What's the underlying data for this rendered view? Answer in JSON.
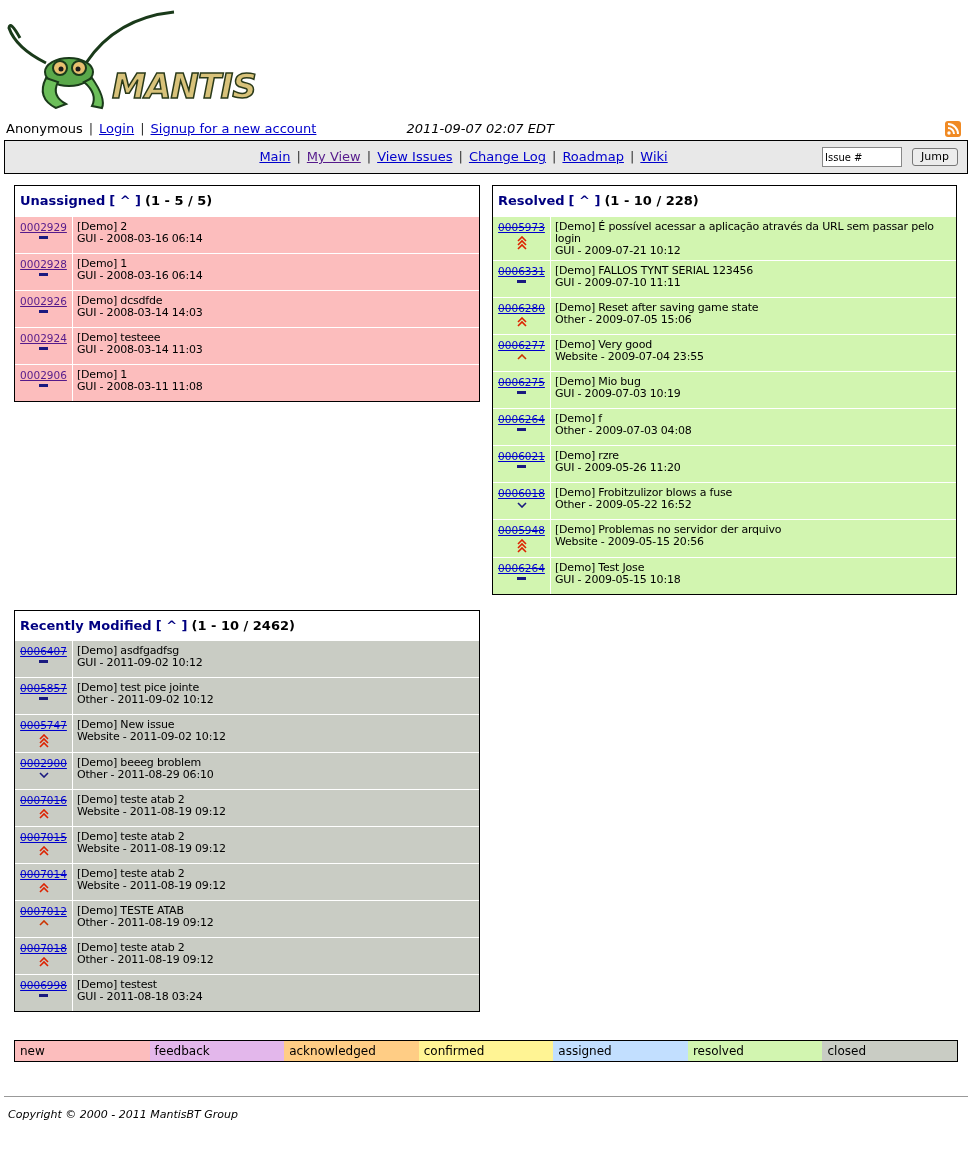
{
  "logo": {
    "text": "MANTIS"
  },
  "user_bar": {
    "user": "Anonymous",
    "separator": "|",
    "links": [
      "Login",
      "Signup for a new account"
    ],
    "datetime": "2011-09-07 02:07 EDT"
  },
  "menu": {
    "separator": "|",
    "links": [
      {
        "label": "Main",
        "visited": false
      },
      {
        "label": "My View",
        "visited": true
      },
      {
        "label": "View Issues",
        "visited": false
      },
      {
        "label": "Change Log",
        "visited": false
      },
      {
        "label": "Roadmap",
        "visited": false
      },
      {
        "label": "Wiki",
        "visited": false
      }
    ],
    "jump": {
      "placeholder": "Issue #",
      "button": "Jump"
    }
  },
  "panels": [
    {
      "title": "Unassigned",
      "toggle": "[ ^ ]",
      "range": "(1 - 5 / 5)",
      "color": "#fcbdbd",
      "ids_struck": false,
      "rows": [
        {
          "id": "0002929",
          "visited": true,
          "kind": "normal",
          "summary": "[Demo] 2",
          "meta": "GUI - 2008-03-16 06:14"
        },
        {
          "id": "0002928",
          "visited": true,
          "kind": "normal",
          "summary": "[Demo] 1",
          "meta": "GUI - 2008-03-16 06:14"
        },
        {
          "id": "0002926",
          "visited": true,
          "kind": "normal",
          "summary": "[Demo] dcsdfde",
          "meta": "GUI - 2008-03-14 14:03"
        },
        {
          "id": "0002924",
          "visited": true,
          "kind": "normal",
          "summary": "[Demo] testeee",
          "meta": "GUI - 2008-03-14 11:03"
        },
        {
          "id": "0002906",
          "visited": true,
          "kind": "normal",
          "summary": "[Demo] 1",
          "meta": "GUI - 2008-03-11 11:08"
        }
      ]
    },
    {
      "title": "Resolved",
      "toggle": "[ ^ ]",
      "range": "(1 - 10 / 228)",
      "color": "#d2f5b0",
      "ids_struck": true,
      "rows": [
        {
          "id": "0005973",
          "visited": false,
          "kind": "immediate",
          "summary": "[Demo] É possível acessar a aplicação através da URL sem passar pelo login",
          "meta": "GUI - 2009-07-21 10:12"
        },
        {
          "id": "0006331",
          "visited": false,
          "kind": "normal",
          "summary": "[Demo] FALLOS TYNT SERIAL 123456",
          "meta": "GUI - 2009-07-10 11:11"
        },
        {
          "id": "0006280",
          "visited": false,
          "kind": "urgent",
          "summary": "[Demo] Reset after saving game state",
          "meta": "Other - 2009-07-05 15:06"
        },
        {
          "id": "0006277",
          "visited": false,
          "kind": "high",
          "summary": "[Demo] Very good",
          "meta": "Website - 2009-07-04 23:55"
        },
        {
          "id": "0006275",
          "visited": false,
          "kind": "normal",
          "summary": "[Demo] Mio bug",
          "meta": "GUI - 2009-07-03 10:19"
        },
        {
          "id": "0006264",
          "visited": false,
          "kind": "normal",
          "summary": "[Demo] f",
          "meta": "Other - 2009-07-03 04:08"
        },
        {
          "id": "0006021",
          "visited": false,
          "kind": "normal",
          "summary": "[Demo] rzre",
          "meta": "GUI - 2009-05-26 11:20"
        },
        {
          "id": "0006018",
          "visited": false,
          "kind": "low",
          "summary": "[Demo] Frobitzulizor blows a fuse",
          "meta": "Other - 2009-05-22 16:52"
        },
        {
          "id": "0005948",
          "visited": false,
          "kind": "immediate",
          "summary": "[Demo] Problemas no servidor der arquivo",
          "meta": "Website - 2009-05-15 20:56"
        },
        {
          "id": "0006264",
          "visited": false,
          "kind": "normal",
          "summary": "[Demo] Test Jose",
          "meta": "GUI - 2009-05-15 10:18"
        }
      ]
    },
    {
      "title": "Recently Modified",
      "toggle": "[ ^ ]",
      "range": "(1 - 10 / 2462)",
      "color": "#c9ccc4",
      "ids_struck": true,
      "rows": [
        {
          "id": "0006407",
          "visited": false,
          "kind": "normal",
          "summary": "[Demo] asdfgadfsg",
          "meta": "GUI - 2011-09-02 10:12"
        },
        {
          "id": "0005857",
          "visited": false,
          "kind": "normal",
          "summary": "[Demo] test pice jointe",
          "meta": "Other - 2011-09-02 10:12"
        },
        {
          "id": "0005747",
          "visited": false,
          "kind": "immediate",
          "summary": "[Demo] New issue",
          "meta": "Website - 2011-09-02 10:12"
        },
        {
          "id": "0002900",
          "visited": false,
          "kind": "low",
          "summary": "[Demo] beeeg broblem",
          "meta": "Other - 2011-08-29 06:10"
        },
        {
          "id": "0007016",
          "visited": false,
          "kind": "urgent",
          "summary": "[Demo] teste atab 2",
          "meta": "Website - 2011-08-19 09:12"
        },
        {
          "id": "0007015",
          "visited": false,
          "kind": "urgent",
          "summary": "[Demo] teste atab 2",
          "meta": "Website - 2011-08-19 09:12"
        },
        {
          "id": "0007014",
          "visited": false,
          "kind": "urgent",
          "summary": "[Demo] teste atab 2",
          "meta": "Website - 2011-08-19 09:12"
        },
        {
          "id": "0007012",
          "visited": false,
          "kind": "high",
          "summary": "[Demo] TESTE ATAB",
          "meta": "Other - 2011-08-19 09:12"
        },
        {
          "id": "0007018",
          "visited": false,
          "kind": "urgent",
          "summary": "[Demo] teste atab 2",
          "meta": "Other - 2011-08-19 09:12"
        },
        {
          "id": "0006998",
          "visited": false,
          "kind": "normal",
          "summary": "[Demo] testest",
          "meta": "GUI - 2011-08-18 03:24"
        }
      ]
    }
  ],
  "legend": [
    {
      "label": "new",
      "color": "#fcbdbd"
    },
    {
      "label": "feedback",
      "color": "#e3b7eb"
    },
    {
      "label": "acknowledged",
      "color": "#ffcd85"
    },
    {
      "label": "confirmed",
      "color": "#fff494"
    },
    {
      "label": "assigned",
      "color": "#c2dfff"
    },
    {
      "label": "resolved",
      "color": "#d2f5b0"
    },
    {
      "label": "closed",
      "color": "#c9ccc4"
    }
  ],
  "footer": {
    "copyright": "Copyright © 2000 - 2011 MantisBT Group"
  }
}
